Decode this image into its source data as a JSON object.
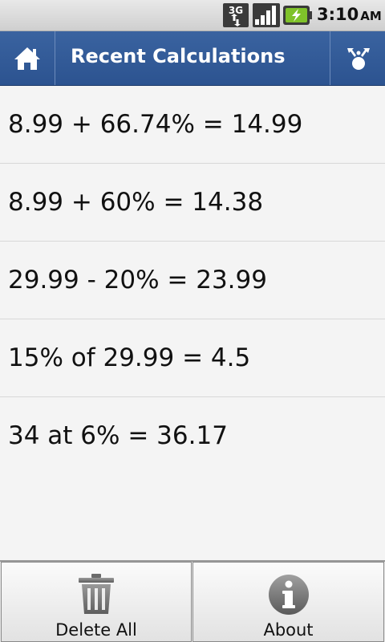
{
  "status_bar": {
    "network_label": "3G",
    "time": "3:10",
    "ampm": "AM"
  },
  "action_bar": {
    "title": "Recent Calculations",
    "home_icon": "home-icon",
    "share_icon": "share-icon",
    "color": "#2f5894"
  },
  "calculations": [
    "8.99 + 66.74% = 14.99",
    "8.99 + 60% = 14.38",
    "29.99 - 20% = 23.99",
    "15% of 29.99 = 4.5",
    "34 at 6% = 36.17"
  ],
  "menu": {
    "delete_all_label": "Delete All",
    "about_label": "About"
  }
}
